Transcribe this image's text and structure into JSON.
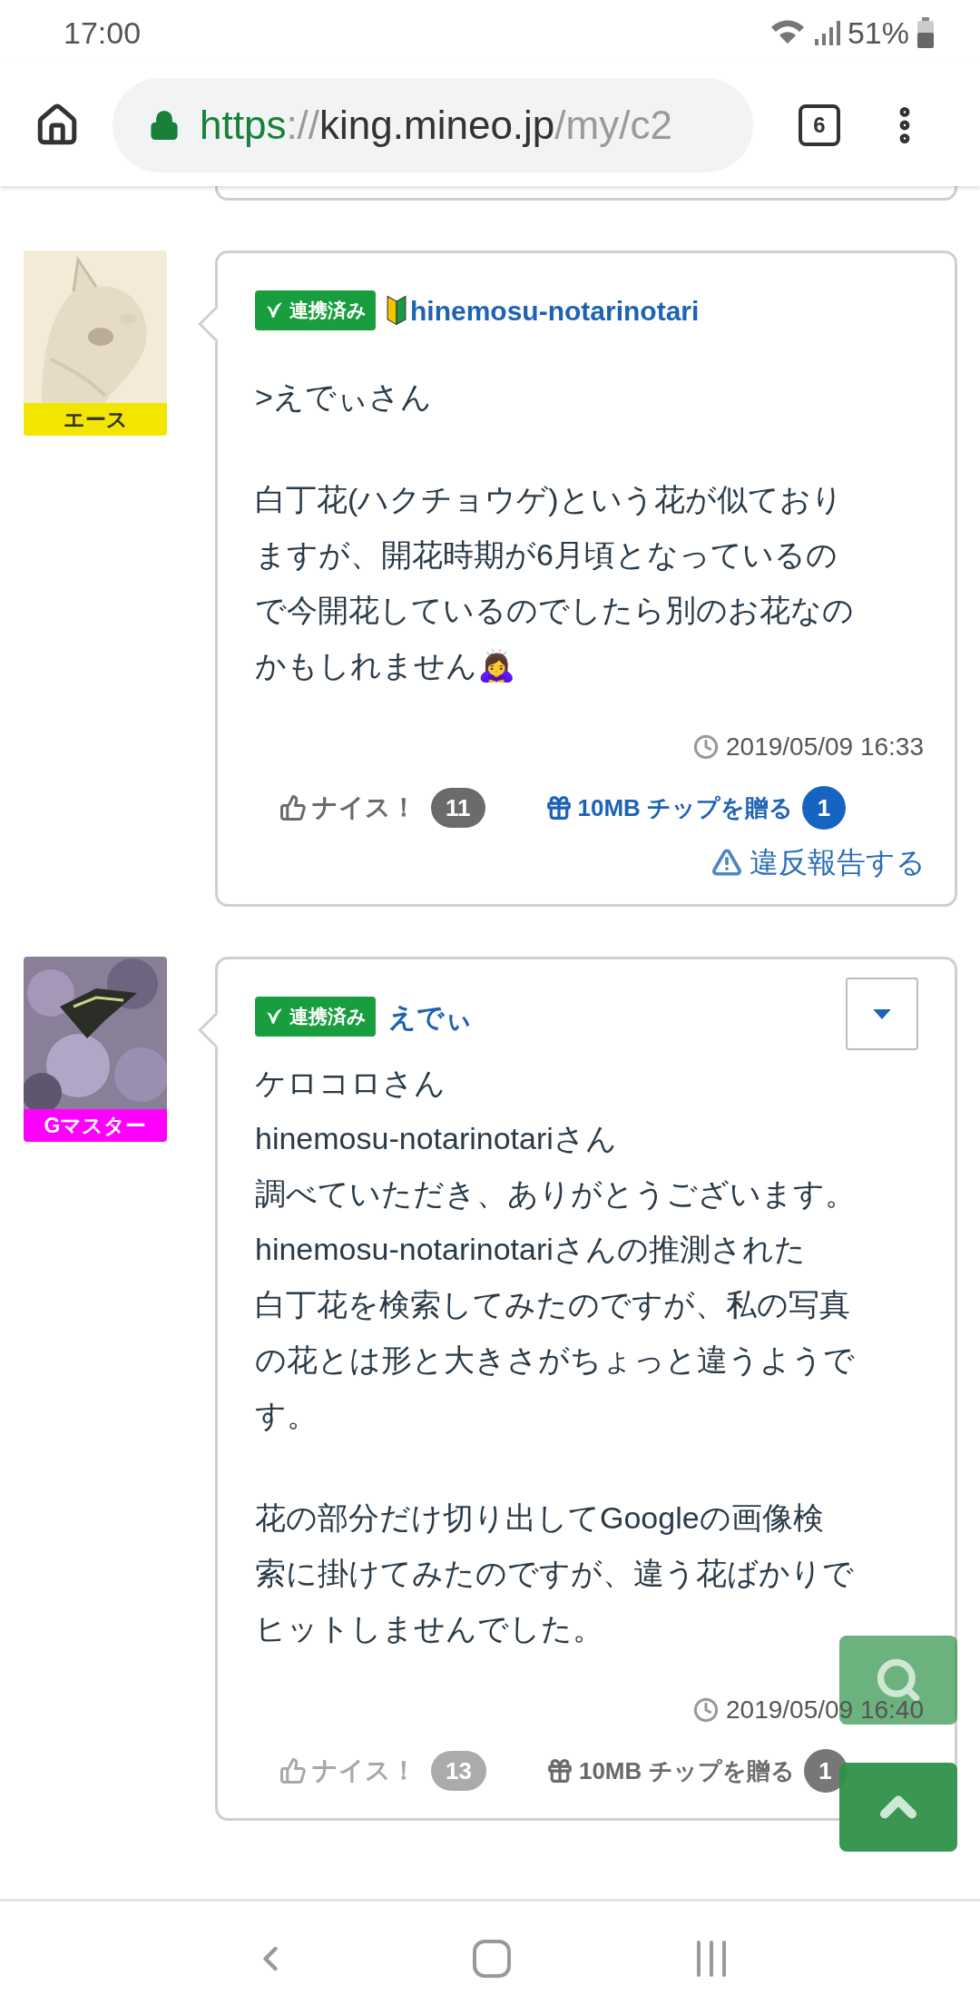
{
  "status_bar": {
    "time": "17:00",
    "battery_text": "51%"
  },
  "address_bar": {
    "scheme": "https",
    "separator": "://",
    "host": "king.mineo.jp",
    "path": "/my/c2",
    "tab_count": "6"
  },
  "posts": [
    {
      "rank": {
        "label": "エース",
        "color": "#f2e600"
      },
      "linked_label": "連携済み",
      "beginner_mark": true,
      "author": "hinemosu-notarinotari",
      "menu_button": false,
      "paragraphs": [
        [
          ">えでぃさん"
        ],
        [
          "白丁花(ハクチョウゲ)という花が似ており",
          "ますが、開花時期が6月頃となっているの",
          "で今開花しているのでしたら別のお花なの",
          "かもしれません🙇‍♀️"
        ]
      ],
      "timestamp": "2019/05/09 16:33",
      "nice": {
        "label": "ナイス！",
        "count": "11"
      },
      "tip": {
        "label": "10MB チップを贈る",
        "count": "1"
      },
      "actions_disabled": false,
      "report": "違反報告する"
    },
    {
      "rank": {
        "label": "Gマスター",
        "color": "#ff00ff"
      },
      "linked_label": "連携済み",
      "beginner_mark": false,
      "author": "えでぃ",
      "menu_button": true,
      "paragraphs": [
        [
          "ケロコロさん",
          "hinemosu-notarinotariさん",
          "調べていただき、ありがとうございます。",
          "hinemosu-notarinotariさんの推測された",
          "白丁花を検索してみたのですが、私の写真",
          "の花とは形と大きさがちょっと違うようで",
          "す。"
        ],
        [
          "花の部分だけ切り出してGoogleの画像検",
          "索に掛けてみたのですが、違う花ばかりで",
          "ヒットしませんでした。"
        ]
      ],
      "timestamp": "2019/05/09 16:40",
      "nice": {
        "label": "ナイス！",
        "count": "13"
      },
      "tip": {
        "label": "10MB チップを贈る",
        "count": "1"
      },
      "actions_disabled": true
    }
  ]
}
